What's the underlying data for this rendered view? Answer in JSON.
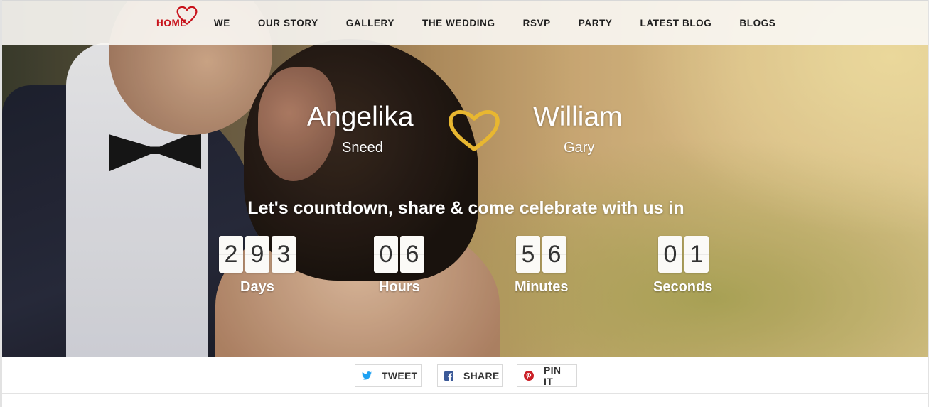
{
  "nav": {
    "items": [
      {
        "label": "HOME"
      },
      {
        "label": "WE"
      },
      {
        "label": "OUR STORY"
      },
      {
        "label": "GALLERY"
      },
      {
        "label": "THE WEDDING"
      },
      {
        "label": "RSVP"
      },
      {
        "label": "PARTY"
      },
      {
        "label": "LATEST BLOG"
      },
      {
        "label": "BLOGS"
      }
    ],
    "active_color": "#c8121b"
  },
  "couple": {
    "bride_first": "Angelika",
    "bride_last": "Sneed",
    "groom_first": "William",
    "groom_last": "Gary",
    "heart_color": "#e8b730"
  },
  "tagline": "Let's countdown, share & come celebrate with us in",
  "countdown": {
    "days": {
      "digits": [
        "2",
        "9",
        "3"
      ],
      "label": "Days"
    },
    "hours": {
      "digits": [
        "0",
        "6"
      ],
      "label": "Hours"
    },
    "minutes": {
      "digits": [
        "5",
        "6"
      ],
      "label": "Minutes"
    },
    "seconds": {
      "digits": [
        "0",
        "1"
      ],
      "label": "Seconds"
    }
  },
  "share": {
    "tweet": {
      "label": "TWEET",
      "icon": "twitter-icon",
      "color": "#1da1f2"
    },
    "share": {
      "label": "SHARE",
      "icon": "facebook-icon",
      "color": "#3b5998"
    },
    "pin": {
      "label": "PIN IT",
      "icon": "pinterest-icon",
      "color": "#cb2027"
    }
  }
}
